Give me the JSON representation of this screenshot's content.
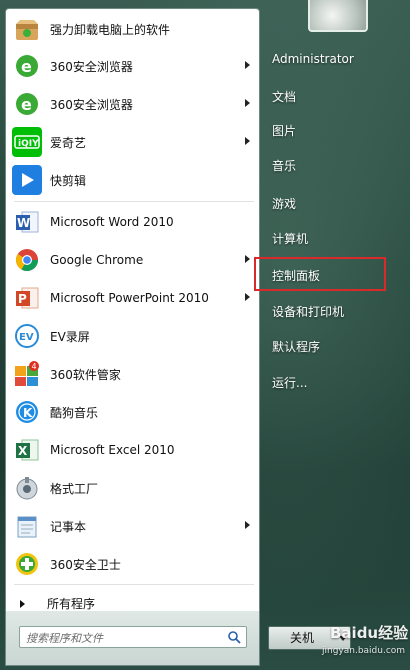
{
  "start_menu": {
    "programs": [
      {
        "label": "强力卸载电脑上的软件",
        "icon": "uninstall-box-icon",
        "has_submenu": false
      },
      {
        "label": "360安全浏览器",
        "icon": "360-browser-icon",
        "has_submenu": true
      },
      {
        "label": "360安全浏览器",
        "icon": "360-browser-icon",
        "has_submenu": true
      },
      {
        "label": "爱奇艺",
        "icon": "iqiyi-icon",
        "has_submenu": true
      },
      {
        "label": "快剪辑",
        "icon": "quick-clip-icon",
        "has_submenu": false
      },
      {
        "label": "Microsoft Word 2010",
        "icon": "word-icon",
        "has_submenu": false
      },
      {
        "label": "Google Chrome",
        "icon": "chrome-icon",
        "has_submenu": true
      },
      {
        "label": "Microsoft PowerPoint 2010",
        "icon": "powerpoint-icon",
        "has_submenu": true
      },
      {
        "label": "EV录屏",
        "icon": "ev-recorder-icon",
        "has_submenu": false
      },
      {
        "label": "360软件管家",
        "icon": "360-software-manager-icon",
        "has_submenu": false
      },
      {
        "label": "酷狗音乐",
        "icon": "kugou-icon",
        "has_submenu": false
      },
      {
        "label": "Microsoft Excel 2010",
        "icon": "excel-icon",
        "has_submenu": false
      },
      {
        "label": "格式工厂",
        "icon": "format-factory-icon",
        "has_submenu": false
      },
      {
        "label": "记事本",
        "icon": "notepad-icon",
        "has_submenu": true
      },
      {
        "label": "360安全卫士",
        "icon": "360-security-icon",
        "has_submenu": false
      }
    ],
    "all_programs_label": "所有程序",
    "search_placeholder": "搜索程序和文件",
    "right_items": [
      {
        "label": "Administrator"
      },
      {
        "label": "文档"
      },
      {
        "label": "图片"
      },
      {
        "label": "音乐"
      },
      {
        "label": "游戏"
      },
      {
        "label": "计算机"
      },
      {
        "label": "控制面板",
        "highlighted": true
      },
      {
        "label": "设备和打印机"
      },
      {
        "label": "默认程序"
      },
      {
        "label": "运行..."
      }
    ],
    "shutdown_label": "关机",
    "highlight_color": "#d9292b"
  },
  "watermark": {
    "brand": "Baidu经验",
    "url": "jingyan.baidu.com"
  }
}
